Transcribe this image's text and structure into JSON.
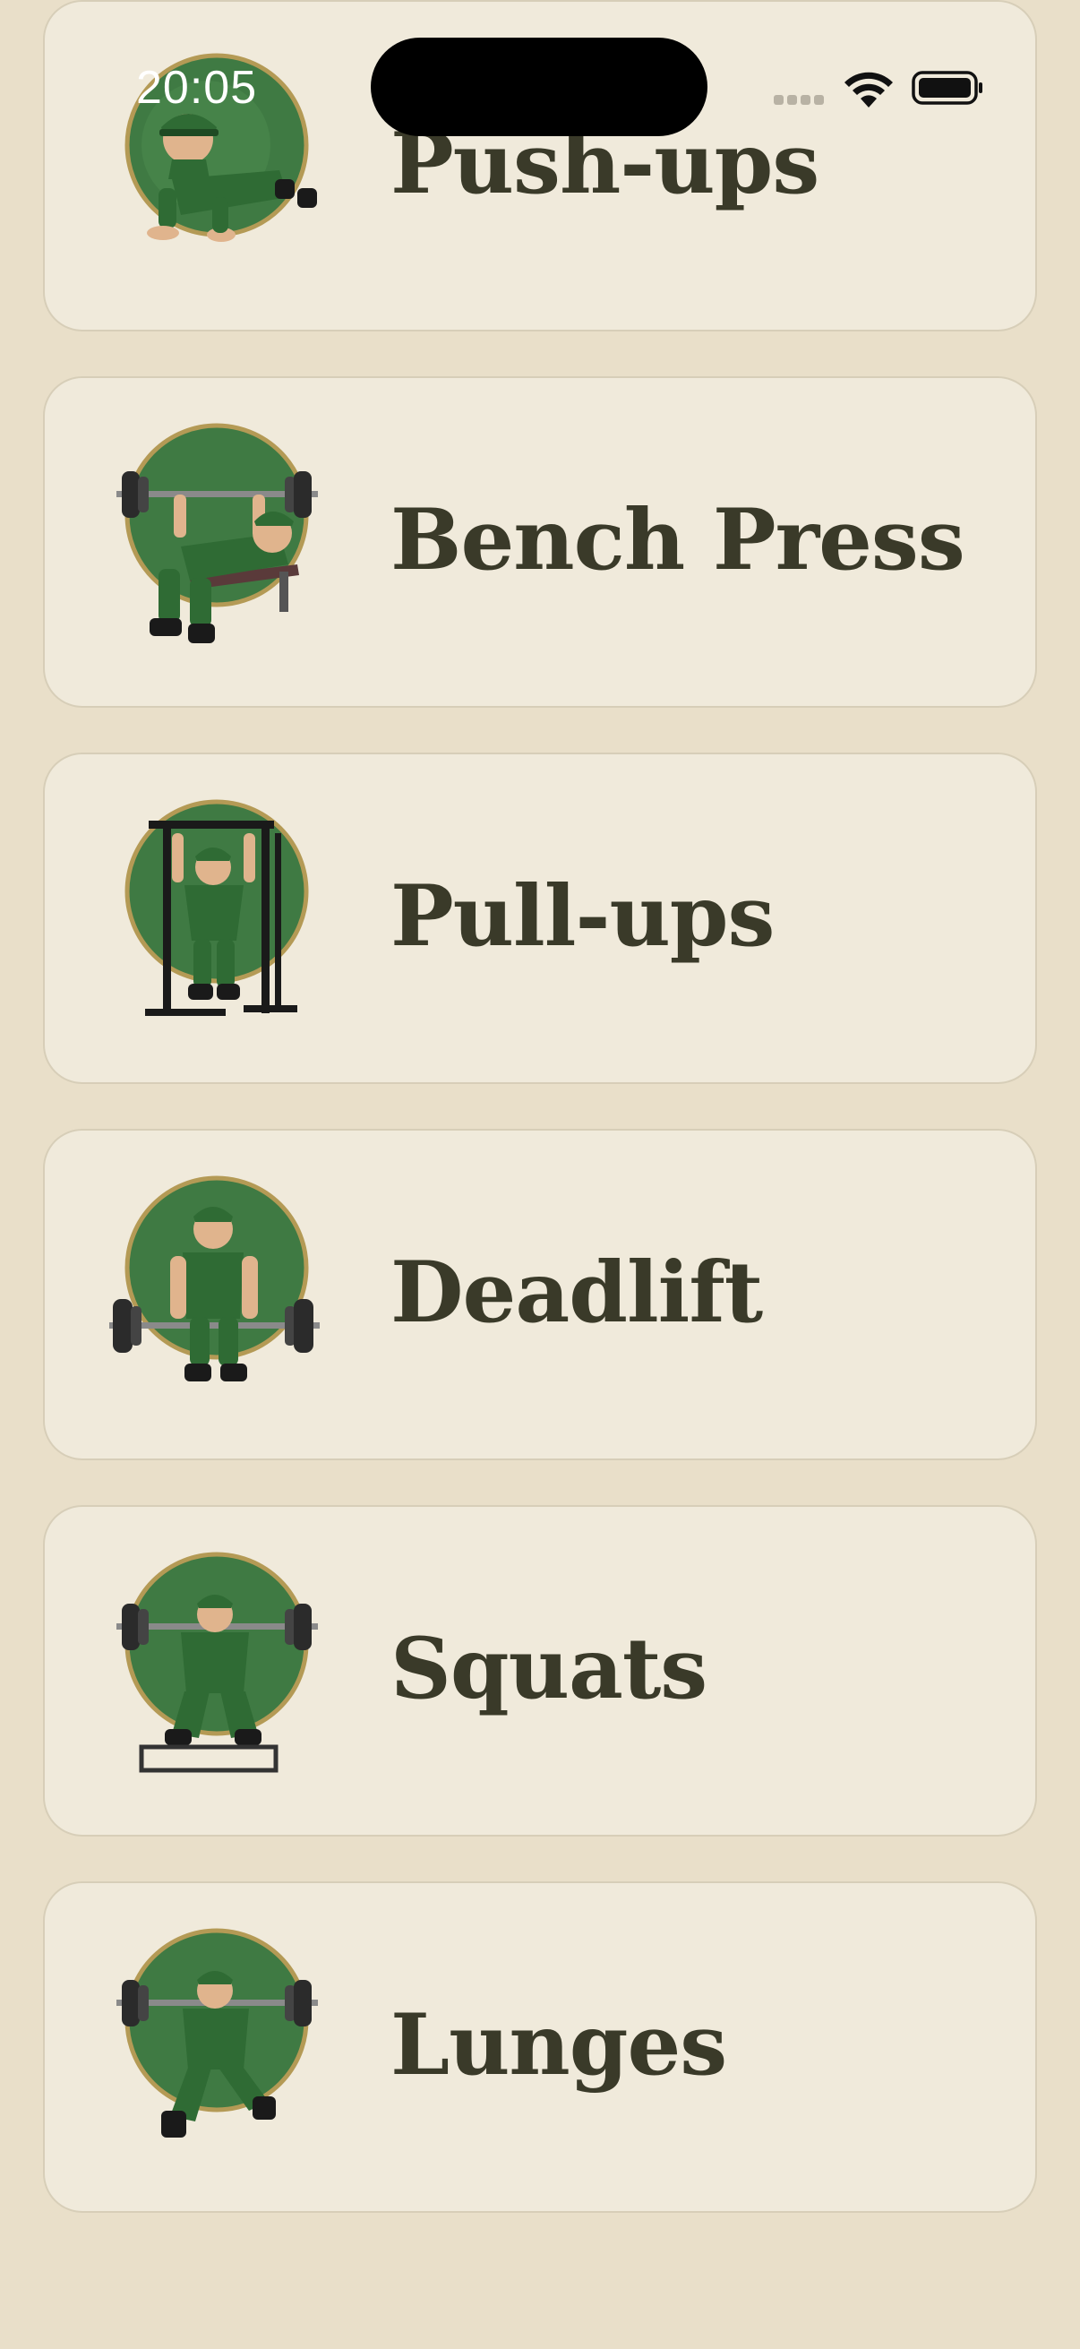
{
  "status_bar": {
    "time": "20:05",
    "icons": [
      "cellular-signal-icon",
      "wifi-icon",
      "battery-icon"
    ]
  },
  "exercises": [
    {
      "label": "Push-ups",
      "icon": "pushup-soldier-icon"
    },
    {
      "label": "Bench Press",
      "icon": "bench-press-soldier-icon"
    },
    {
      "label": "Pull-ups",
      "icon": "pullup-soldier-icon"
    },
    {
      "label": "Deadlift",
      "icon": "deadlift-soldier-icon"
    },
    {
      "label": "Squats",
      "icon": "squat-soldier-icon"
    },
    {
      "label": "Lunges",
      "icon": "lunge-soldier-icon"
    }
  ],
  "colors": {
    "background": "#e9dfc9",
    "card": "#f0eadb",
    "card_border": "#d7ceb8",
    "text": "#3a3a29",
    "avatar_green": "#3f7a43",
    "avatar_ring": "#b49a55"
  }
}
